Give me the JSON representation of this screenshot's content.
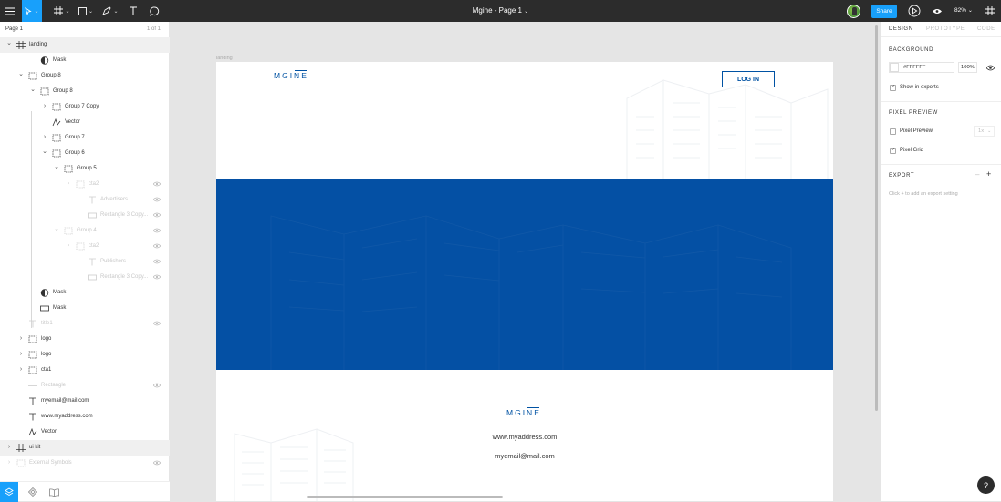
{
  "toolbar": {
    "doc_title": "Mgine - Page 1",
    "share_label": "Share",
    "zoom": "82%",
    "accent": "#18a0fb"
  },
  "layers": {
    "page_name": "Page 1",
    "page_count": "1 of 1",
    "rows": [
      {
        "label": "landing",
        "depth": 0,
        "chevron": "down",
        "icon": "frame-icon",
        "highlight": true
      },
      {
        "label": "Mask",
        "depth": 2,
        "chevron": "",
        "icon": "mask-icon"
      },
      {
        "label": "Group 8",
        "depth": 1,
        "chevron": "down",
        "icon": "group-icon"
      },
      {
        "label": "Group 8",
        "depth": 2,
        "chevron": "down",
        "icon": "group-icon"
      },
      {
        "label": "Group 7 Copy",
        "depth": 3,
        "chevron": "right",
        "icon": "group-icon"
      },
      {
        "label": "Vector",
        "depth": 3,
        "chevron": "",
        "icon": "vector-icon"
      },
      {
        "label": "Group 7",
        "depth": 3,
        "chevron": "right",
        "icon": "group-icon"
      },
      {
        "label": "Group 6",
        "depth": 3,
        "chevron": "down",
        "icon": "group-icon"
      },
      {
        "label": "Group 5",
        "depth": 4,
        "chevron": "down",
        "icon": "group-icon"
      },
      {
        "label": "cta2",
        "depth": 5,
        "chevron": "right",
        "icon": "group-icon",
        "dim": true,
        "eye": true
      },
      {
        "label": "Advertisers",
        "depth": 6,
        "chevron": "",
        "icon": "text-icon",
        "dim": true,
        "eye": true
      },
      {
        "label": "Rectangle 3 Copy...",
        "depth": 6,
        "chevron": "",
        "icon": "rect-icon",
        "dim": true,
        "eye": true
      },
      {
        "label": "Group 4",
        "depth": 4,
        "chevron": "down",
        "icon": "group-icon",
        "dim": true,
        "eye": true
      },
      {
        "label": "cta2",
        "depth": 5,
        "chevron": "right",
        "icon": "group-icon",
        "dim": true,
        "eye": true
      },
      {
        "label": "Publishers",
        "depth": 6,
        "chevron": "",
        "icon": "text-icon",
        "dim": true,
        "eye": true
      },
      {
        "label": "Rectangle 3 Copy...",
        "depth": 6,
        "chevron": "",
        "icon": "rect-icon",
        "dim": true,
        "eye": true
      },
      {
        "label": "Mask",
        "depth": 2,
        "chevron": "",
        "icon": "mask-icon"
      },
      {
        "label": "Mask",
        "depth": 2,
        "chevron": "",
        "icon": "rect-icon"
      },
      {
        "label": "title1",
        "depth": 1,
        "chevron": "",
        "icon": "text-icon",
        "dim": true,
        "eye": true
      },
      {
        "label": "logo",
        "depth": 1,
        "chevron": "right",
        "icon": "group-icon"
      },
      {
        "label": "logo",
        "depth": 1,
        "chevron": "right",
        "icon": "group-icon"
      },
      {
        "label": "cta1",
        "depth": 1,
        "chevron": "right",
        "icon": "group-icon"
      },
      {
        "label": "Rectangle",
        "depth": 1,
        "chevron": "",
        "icon": "line-icon",
        "dim": true,
        "eye": true
      },
      {
        "label": "myemail@mail.com",
        "depth": 1,
        "chevron": "",
        "icon": "text-icon"
      },
      {
        "label": "www.myaddress.com",
        "depth": 1,
        "chevron": "",
        "icon": "text-icon"
      },
      {
        "label": "Vector",
        "depth": 1,
        "chevron": "",
        "icon": "vector-icon"
      },
      {
        "label": "ui kit",
        "depth": 0,
        "chevron": "right",
        "icon": "frame-icon",
        "highlight": true
      },
      {
        "label": "External Symbols",
        "depth": 0,
        "chevron": "right",
        "icon": "group-icon",
        "dim": true,
        "eye": true
      }
    ]
  },
  "canvas": {
    "frame_label": "landing",
    "logo": "MGINE",
    "login_label": "LOG IN",
    "footer_logo": "MGINE",
    "footer_address": "www.myaddress.com",
    "footer_email": "myemail@mail.com",
    "brand_blue": "#0450a4"
  },
  "props": {
    "tabs": [
      "DESIGN",
      "PROTOTYPE",
      "CODE"
    ],
    "background_title": "BACKGROUND",
    "bg_hex": "#FFFFFF",
    "bg_opacity": "100%",
    "show_in_exports": "Show in exports",
    "pixel_preview_title": "PIXEL PREVIEW",
    "pixel_preview_label": "Pixel Preview",
    "pixel_preview_scale": "1x",
    "pixel_grid_label": "Pixel Grid",
    "export_title": "EXPORT",
    "export_hint": "Click + to add an export setting"
  },
  "help": "?"
}
